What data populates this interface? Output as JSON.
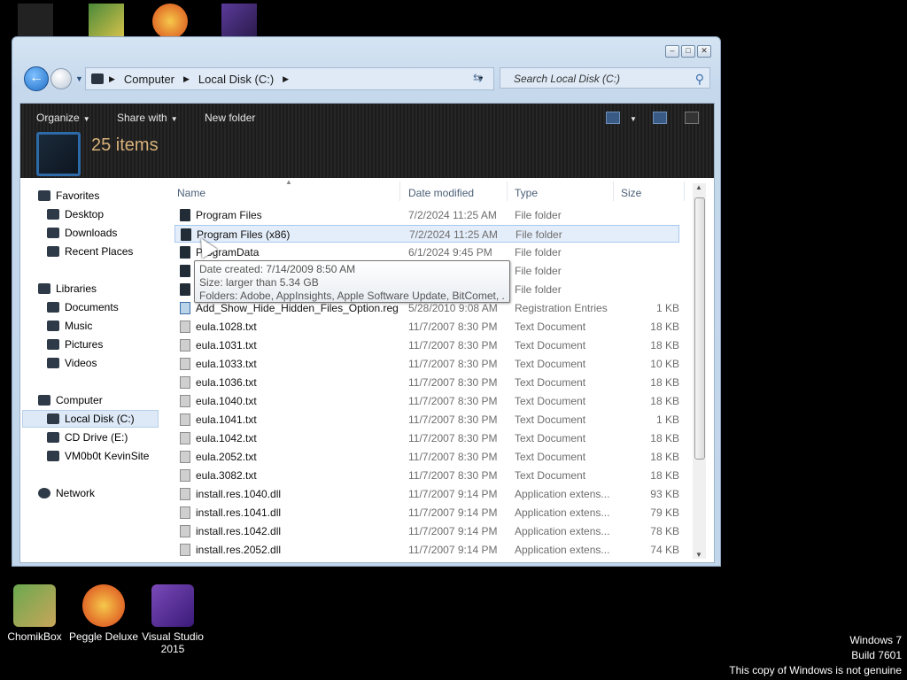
{
  "window": {
    "address": {
      "crumbs": [
        "Computer",
        "Local Disk (C:)"
      ]
    },
    "search_placeholder": "Search Local Disk (C:)",
    "caption_buttons": [
      "minimize",
      "maximize",
      "close"
    ]
  },
  "toolbar": {
    "organize": "Organize",
    "share_with": "Share with",
    "new_folder": "New folder",
    "item_count": "25 items"
  },
  "nav": {
    "favorites": "Favorites",
    "desktop": "Desktop",
    "downloads": "Downloads",
    "recent_places": "Recent Places",
    "libraries": "Libraries",
    "documents": "Documents",
    "music": "Music",
    "pictures": "Pictures",
    "videos": "Videos",
    "computer": "Computer",
    "local_disk": "Local Disk (C:)",
    "cd_drive": "CD Drive (E:)",
    "vm_site": "VM0b0t KevinSite",
    "network": "Network"
  },
  "columns": {
    "name": "Name",
    "date": "Date modified",
    "type": "Type",
    "size": "Size"
  },
  "rows": [
    {
      "name": "Program Files",
      "date": "7/2/2024 11:25 AM",
      "type": "File folder",
      "size": "",
      "icon": "folder"
    },
    {
      "name": "Program Files (x86)",
      "date": "7/2/2024 11:25 AM",
      "type": "File folder",
      "size": "",
      "icon": "folder"
    },
    {
      "name": "ProgramData",
      "date": "6/1/2024 9:45 PM",
      "type": "File folder",
      "size": "",
      "icon": "folder"
    },
    {
      "name": "",
      "date": "",
      "type": "File folder",
      "size": "",
      "icon": "folder"
    },
    {
      "name": "",
      "date": "",
      "type": "File folder",
      "size": "",
      "icon": "folder"
    },
    {
      "name": "Add_Show_Hide_Hidden_Files_Option.reg",
      "date": "5/28/2010 9:08 AM",
      "type": "Registration Entries",
      "size": "1 KB",
      "icon": "reg"
    },
    {
      "name": "eula.1028.txt",
      "date": "11/7/2007 8:30 PM",
      "type": "Text Document",
      "size": "18 KB",
      "icon": "doc"
    },
    {
      "name": "eula.1031.txt",
      "date": "11/7/2007 8:30 PM",
      "type": "Text Document",
      "size": "18 KB",
      "icon": "doc"
    },
    {
      "name": "eula.1033.txt",
      "date": "11/7/2007 8:30 PM",
      "type": "Text Document",
      "size": "10 KB",
      "icon": "doc"
    },
    {
      "name": "eula.1036.txt",
      "date": "11/7/2007 8:30 PM",
      "type": "Text Document",
      "size": "18 KB",
      "icon": "doc"
    },
    {
      "name": "eula.1040.txt",
      "date": "11/7/2007 8:30 PM",
      "type": "Text Document",
      "size": "18 KB",
      "icon": "doc"
    },
    {
      "name": "eula.1041.txt",
      "date": "11/7/2007 8:30 PM",
      "type": "Text Document",
      "size": "1 KB",
      "icon": "doc"
    },
    {
      "name": "eula.1042.txt",
      "date": "11/7/2007 8:30 PM",
      "type": "Text Document",
      "size": "18 KB",
      "icon": "doc"
    },
    {
      "name": "eula.2052.txt",
      "date": "11/7/2007 8:30 PM",
      "type": "Text Document",
      "size": "18 KB",
      "icon": "doc"
    },
    {
      "name": "eula.3082.txt",
      "date": "11/7/2007 8:30 PM",
      "type": "Text Document",
      "size": "18 KB",
      "icon": "doc"
    },
    {
      "name": "install.res.1040.dll",
      "date": "11/7/2007 9:14 PM",
      "type": "Application extens...",
      "size": "93 KB",
      "icon": "doc"
    },
    {
      "name": "install.res.1041.dll",
      "date": "11/7/2007 9:14 PM",
      "type": "Application extens...",
      "size": "79 KB",
      "icon": "doc"
    },
    {
      "name": "install.res.1042.dll",
      "date": "11/7/2007 9:14 PM",
      "type": "Application extens...",
      "size": "78 KB",
      "icon": "doc"
    },
    {
      "name": "install.res.2052.dll",
      "date": "11/7/2007 9:14 PM",
      "type": "Application extens...",
      "size": "74 KB",
      "icon": "doc"
    }
  ],
  "tooltip": {
    "line1": "Date created: 7/14/2009 8:50 AM",
    "line2": "Size: larger than 5.34 GB",
    "line3": "Folders: Adobe, AppInsights, Apple Software Update, BitComet, ..."
  },
  "desktop": {
    "icons": [
      "ChomikBox",
      "Peggle Deluxe",
      "Visual Studio 2015"
    ],
    "watermark": {
      "line1": "Windows 7",
      "line2": "Build 7601",
      "line3": "This copy of Windows is not genuine"
    }
  },
  "colors": {
    "toolbar_bg": "#222222",
    "item_count": "#d8b27a",
    "selection": "#e4eefa",
    "accent": "#2d6aa8"
  }
}
